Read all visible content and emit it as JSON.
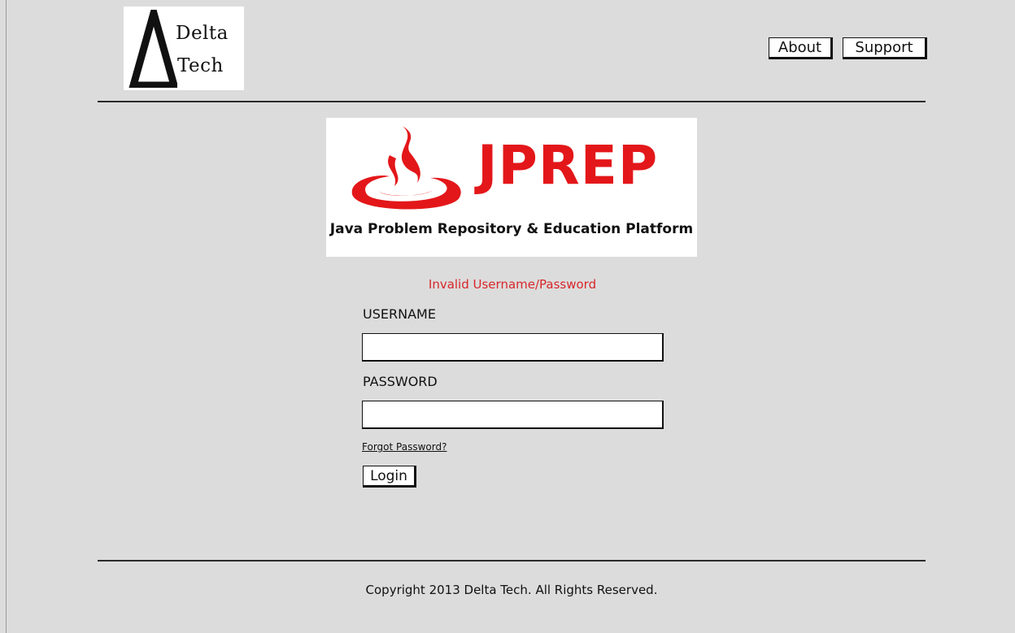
{
  "header": {
    "logo": {
      "line1": "Delta",
      "line2": "Tech",
      "icon": "delta-triangle-icon"
    },
    "nav": {
      "about_label": "About",
      "support_label": "Support"
    }
  },
  "banner": {
    "icon": "java-flame-cup-icon",
    "product_name": "JPREP",
    "tagline": "Java Problem Repository & Education Platform",
    "brand_color": "#e3171a"
  },
  "login_form": {
    "error_message": "Invalid Username/Password",
    "error_color": "#d8262a",
    "username_label": "USERNAME",
    "username_value": "",
    "password_label": "PASSWORD",
    "password_value": "",
    "forgot_password_label": "Forgot Password?",
    "login_button_label": "Login"
  },
  "footer": {
    "copyright": "Copyright 2013 Delta Tech. All Rights Reserved."
  },
  "colors": {
    "background": "#dcdcdc",
    "panel": "#ffffff",
    "ink": "#111111"
  }
}
